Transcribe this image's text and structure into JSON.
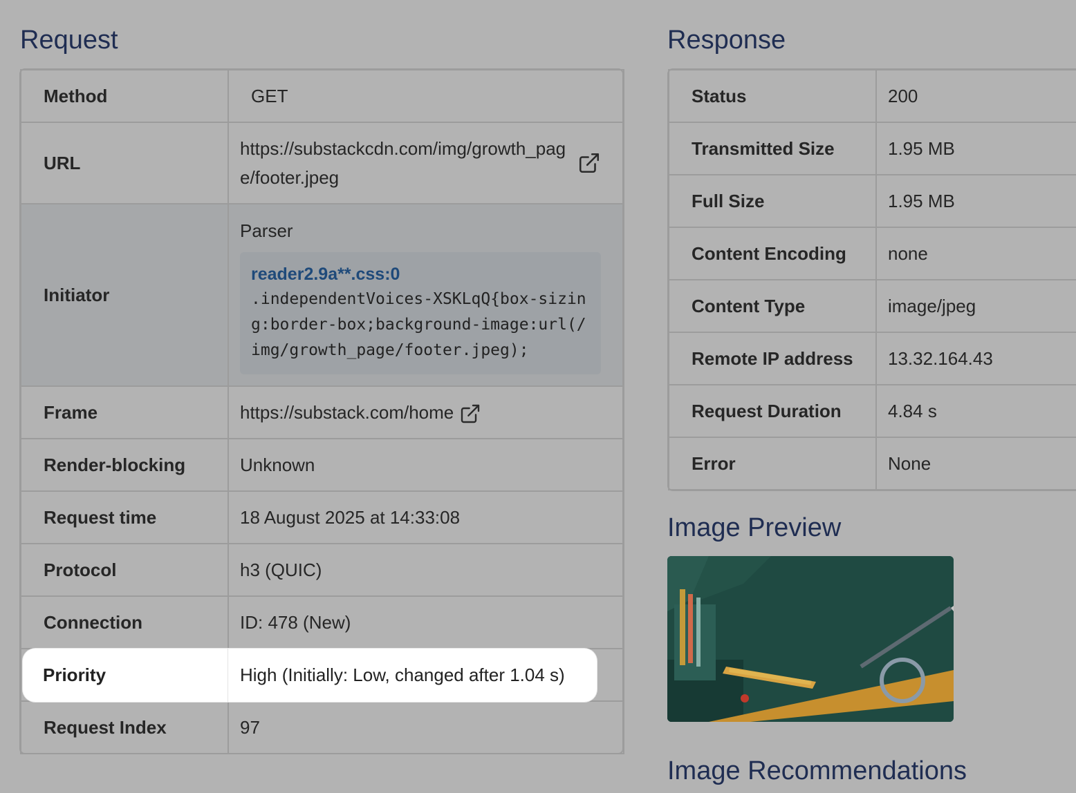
{
  "request": {
    "title": "Request",
    "rows": [
      {
        "key": "Method",
        "value": "GET"
      },
      {
        "key": "URL",
        "value": "https://substackcdn.com/img/growth_page/footer.jpeg",
        "icon": "external-link-icon"
      },
      {
        "key": "Initiator",
        "value": "Parser",
        "code_link": "reader2.9a**.css:0",
        "code": ".independentVoices-XSKLqQ{box-sizing:border-box;background-image:url(/img/growth_page/footer.jpeg);"
      },
      {
        "key": "Frame",
        "value": "https://substack.com/home",
        "icon": "external-link-icon"
      },
      {
        "key": "Render-blocking",
        "value": "Unknown"
      },
      {
        "key": "Request time",
        "value": "18 August 2025 at 14:33:08"
      },
      {
        "key": "Protocol",
        "value": "h3 (QUIC)"
      },
      {
        "key": "Connection",
        "value": "ID: 478 (New)"
      },
      {
        "key": "Priority",
        "value": "High (Initially: Low, changed after 1.04 s)"
      },
      {
        "key": "Request Index",
        "value": "97"
      }
    ]
  },
  "response": {
    "title": "Response",
    "rows": [
      {
        "key": "Status",
        "value": "200"
      },
      {
        "key": "Transmitted Size",
        "value": "1.95 MB"
      },
      {
        "key": "Full Size",
        "value": "1.95 MB"
      },
      {
        "key": "Content Encoding",
        "value": "none"
      },
      {
        "key": "Content Type",
        "value": "image/jpeg"
      },
      {
        "key": "Remote IP address",
        "value": "13.32.164.43"
      },
      {
        "key": "Request Duration",
        "value": "4.84 s"
      },
      {
        "key": "Error",
        "value": "None"
      }
    ]
  },
  "image_preview": {
    "title": "Image Preview"
  },
  "image_recommendations": {
    "title": "Image Recommendations"
  },
  "colors": {
    "title": "#1f2d52",
    "code_link": "#1f4a7a",
    "highlight": "#ffffff",
    "preview_bg": "#1f4a42"
  }
}
